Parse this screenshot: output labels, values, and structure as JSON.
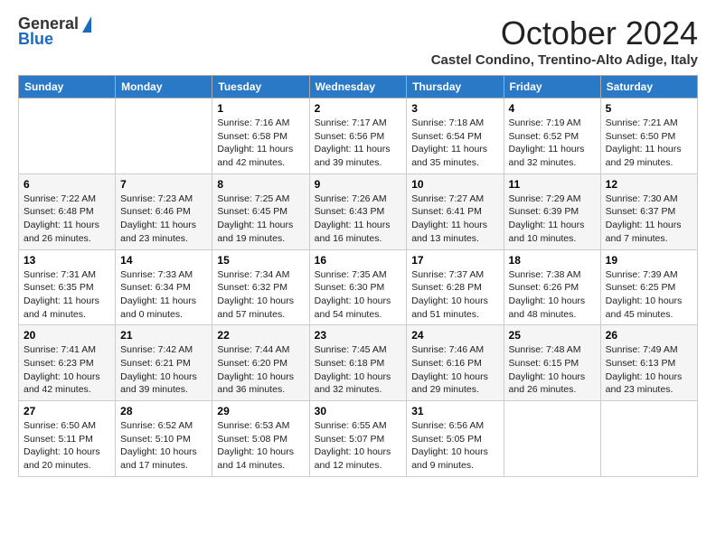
{
  "logo": {
    "general": "General",
    "blue": "Blue"
  },
  "title": "October 2024",
  "subtitle": "Castel Condino, Trentino-Alto Adige, Italy",
  "days_of_week": [
    "Sunday",
    "Monday",
    "Tuesday",
    "Wednesday",
    "Thursday",
    "Friday",
    "Saturday"
  ],
  "weeks": [
    [
      {
        "day": "",
        "info": ""
      },
      {
        "day": "",
        "info": ""
      },
      {
        "day": "1",
        "info": "Sunrise: 7:16 AM\nSunset: 6:58 PM\nDaylight: 11 hours and 42 minutes."
      },
      {
        "day": "2",
        "info": "Sunrise: 7:17 AM\nSunset: 6:56 PM\nDaylight: 11 hours and 39 minutes."
      },
      {
        "day": "3",
        "info": "Sunrise: 7:18 AM\nSunset: 6:54 PM\nDaylight: 11 hours and 35 minutes."
      },
      {
        "day": "4",
        "info": "Sunrise: 7:19 AM\nSunset: 6:52 PM\nDaylight: 11 hours and 32 minutes."
      },
      {
        "day": "5",
        "info": "Sunrise: 7:21 AM\nSunset: 6:50 PM\nDaylight: 11 hours and 29 minutes."
      }
    ],
    [
      {
        "day": "6",
        "info": "Sunrise: 7:22 AM\nSunset: 6:48 PM\nDaylight: 11 hours and 26 minutes."
      },
      {
        "day": "7",
        "info": "Sunrise: 7:23 AM\nSunset: 6:46 PM\nDaylight: 11 hours and 23 minutes."
      },
      {
        "day": "8",
        "info": "Sunrise: 7:25 AM\nSunset: 6:45 PM\nDaylight: 11 hours and 19 minutes."
      },
      {
        "day": "9",
        "info": "Sunrise: 7:26 AM\nSunset: 6:43 PM\nDaylight: 11 hours and 16 minutes."
      },
      {
        "day": "10",
        "info": "Sunrise: 7:27 AM\nSunset: 6:41 PM\nDaylight: 11 hours and 13 minutes."
      },
      {
        "day": "11",
        "info": "Sunrise: 7:29 AM\nSunset: 6:39 PM\nDaylight: 11 hours and 10 minutes."
      },
      {
        "day": "12",
        "info": "Sunrise: 7:30 AM\nSunset: 6:37 PM\nDaylight: 11 hours and 7 minutes."
      }
    ],
    [
      {
        "day": "13",
        "info": "Sunrise: 7:31 AM\nSunset: 6:35 PM\nDaylight: 11 hours and 4 minutes."
      },
      {
        "day": "14",
        "info": "Sunrise: 7:33 AM\nSunset: 6:34 PM\nDaylight: 11 hours and 0 minutes."
      },
      {
        "day": "15",
        "info": "Sunrise: 7:34 AM\nSunset: 6:32 PM\nDaylight: 10 hours and 57 minutes."
      },
      {
        "day": "16",
        "info": "Sunrise: 7:35 AM\nSunset: 6:30 PM\nDaylight: 10 hours and 54 minutes."
      },
      {
        "day": "17",
        "info": "Sunrise: 7:37 AM\nSunset: 6:28 PM\nDaylight: 10 hours and 51 minutes."
      },
      {
        "day": "18",
        "info": "Sunrise: 7:38 AM\nSunset: 6:26 PM\nDaylight: 10 hours and 48 minutes."
      },
      {
        "day": "19",
        "info": "Sunrise: 7:39 AM\nSunset: 6:25 PM\nDaylight: 10 hours and 45 minutes."
      }
    ],
    [
      {
        "day": "20",
        "info": "Sunrise: 7:41 AM\nSunset: 6:23 PM\nDaylight: 10 hours and 42 minutes."
      },
      {
        "day": "21",
        "info": "Sunrise: 7:42 AM\nSunset: 6:21 PM\nDaylight: 10 hours and 39 minutes."
      },
      {
        "day": "22",
        "info": "Sunrise: 7:44 AM\nSunset: 6:20 PM\nDaylight: 10 hours and 36 minutes."
      },
      {
        "day": "23",
        "info": "Sunrise: 7:45 AM\nSunset: 6:18 PM\nDaylight: 10 hours and 32 minutes."
      },
      {
        "day": "24",
        "info": "Sunrise: 7:46 AM\nSunset: 6:16 PM\nDaylight: 10 hours and 29 minutes."
      },
      {
        "day": "25",
        "info": "Sunrise: 7:48 AM\nSunset: 6:15 PM\nDaylight: 10 hours and 26 minutes."
      },
      {
        "day": "26",
        "info": "Sunrise: 7:49 AM\nSunset: 6:13 PM\nDaylight: 10 hours and 23 minutes."
      }
    ],
    [
      {
        "day": "27",
        "info": "Sunrise: 6:50 AM\nSunset: 5:11 PM\nDaylight: 10 hours and 20 minutes."
      },
      {
        "day": "28",
        "info": "Sunrise: 6:52 AM\nSunset: 5:10 PM\nDaylight: 10 hours and 17 minutes."
      },
      {
        "day": "29",
        "info": "Sunrise: 6:53 AM\nSunset: 5:08 PM\nDaylight: 10 hours and 14 minutes."
      },
      {
        "day": "30",
        "info": "Sunrise: 6:55 AM\nSunset: 5:07 PM\nDaylight: 10 hours and 12 minutes."
      },
      {
        "day": "31",
        "info": "Sunrise: 6:56 AM\nSunset: 5:05 PM\nDaylight: 10 hours and 9 minutes."
      },
      {
        "day": "",
        "info": ""
      },
      {
        "day": "",
        "info": ""
      }
    ]
  ]
}
